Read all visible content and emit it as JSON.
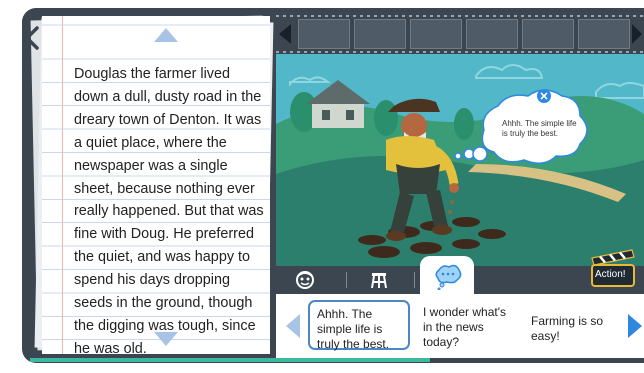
{
  "nav": {
    "back_icon": "chevron-left-icon"
  },
  "story": {
    "text": "Douglas the farmer lived down a dull, dusty road in the dreary town of Denton. It was a quiet place, where the newspaper was a single sheet, because nothing ever really happened. But that was fine with Doug. He preferred the quiet, and was happy to spend his days dropping seeds in the ground, though the digging was tough, since he was old."
  },
  "scene": {
    "speech_bubble": {
      "line1": "Ahhh. The simple life",
      "line2": "is truly the best."
    }
  },
  "toolbar": {
    "items": [
      "face-icon",
      "stool-icon",
      "thought-bubble-icon"
    ],
    "action_label": "Action!"
  },
  "choices": [
    {
      "label": "Ahhh. The simple life is truly the best.",
      "selected": true
    },
    {
      "label": "I wonder what's in the news today?",
      "selected": false
    },
    {
      "label": "Farming is so easy!",
      "selected": false
    }
  ],
  "colors": {
    "accent": "#2f87e0",
    "frame": "#3b4650",
    "progress": "#3cb7a0"
  }
}
